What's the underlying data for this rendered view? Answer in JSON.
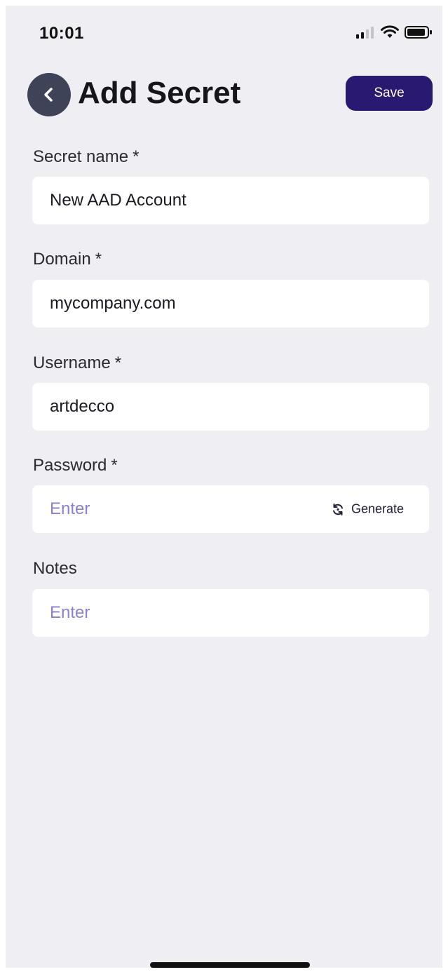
{
  "status_bar": {
    "time": "10:01"
  },
  "header": {
    "title": "Add Secret",
    "save_label": "Save"
  },
  "form": {
    "required_mark": "*",
    "secret_name": {
      "label": "Secret name",
      "value": "New AAD Account"
    },
    "domain": {
      "label": "Domain",
      "value": "mycompany.com"
    },
    "username": {
      "label": "Username",
      "value": "artdecco"
    },
    "password": {
      "label": "Password",
      "placeholder": "Enter",
      "generate_label": "Generate"
    },
    "notes": {
      "label": "Notes",
      "placeholder": "Enter"
    }
  },
  "colors": {
    "accent": "#2a1970",
    "placeholder": "#8e7fd0",
    "background": "#eeeef3",
    "back_button": "#3f4357"
  },
  "icons": {
    "back": "chevron-left-icon",
    "generate": "refresh-icon",
    "signal": "cellular-signal-icon",
    "wifi": "wifi-icon",
    "battery": "battery-icon"
  }
}
